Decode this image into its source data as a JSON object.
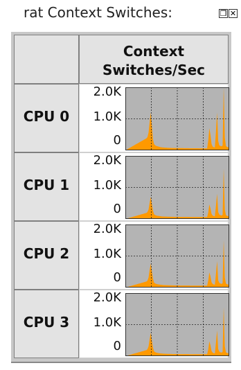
{
  "window": {
    "title": "rat Context Switches:",
    "buttons": {
      "restore_icon": "restore-icon",
      "close_icon": "close-icon"
    }
  },
  "table": {
    "column_header": [
      "Context",
      "Switches/Sec"
    ]
  },
  "rows": [
    {
      "label": "CPU 0"
    },
    {
      "label": "CPU 1"
    },
    {
      "label": "CPU 2"
    },
    {
      "label": "CPU 3"
    }
  ],
  "chart_data": [
    {
      "type": "area",
      "y_ticks": [
        "2.0K",
        "1.0K",
        "0"
      ],
      "ylim": [
        0,
        2000
      ],
      "grid": true,
      "colors": {
        "fill": "#ff9900",
        "background": "#b4b4b4",
        "grid": "#222222"
      },
      "series": [
        {
          "values": [
            0,
            20,
            40,
            60,
            80,
            100,
            120,
            140,
            160,
            180,
            200,
            220,
            240,
            260,
            280,
            300,
            320,
            340,
            360,
            380,
            420,
            560,
            900,
            1200,
            800,
            350,
            200,
            160,
            140,
            130,
            120,
            110,
            100,
            95,
            90,
            90,
            85,
            85,
            80,
            80,
            78,
            76,
            75,
            75,
            74,
            73,
            72,
            72,
            72,
            71,
            70,
            70,
            70,
            69,
            69,
            68,
            68,
            68,
            67,
            67,
            66,
            66,
            66,
            65,
            65,
            65,
            65,
            64,
            64,
            64,
            64,
            64,
            64,
            64,
            64,
            300,
            700,
            500,
            200,
            120,
            100,
            95,
            600,
            1200,
            300,
            160,
            140,
            130,
            150,
            2100,
            400,
            140,
            110,
            100,
            95
          ]
        }
      ]
    },
    {
      "type": "area",
      "y_ticks": [
        "2.0K",
        "1.0K",
        "0"
      ],
      "ylim": [
        0,
        2000
      ],
      "grid": true,
      "colors": {
        "fill": "#ff9900",
        "background": "#b4b4b4",
        "grid": "#222222"
      },
      "series": [
        {
          "values": [
            0,
            10,
            20,
            30,
            40,
            50,
            60,
            70,
            80,
            90,
            100,
            110,
            120,
            130,
            140,
            150,
            160,
            170,
            180,
            190,
            220,
            300,
            520,
            700,
            480,
            260,
            150,
            120,
            110,
            100,
            95,
            90,
            85,
            80,
            78,
            76,
            74,
            73,
            72,
            71,
            70,
            69,
            68,
            68,
            67,
            66,
            66,
            65,
            65,
            64,
            64,
            64,
            63,
            63,
            63,
            62,
            62,
            62,
            62,
            61,
            61,
            61,
            60,
            60,
            60,
            60,
            60,
            60,
            60,
            60,
            60,
            60,
            60,
            60,
            60,
            200,
            460,
            340,
            160,
            110,
            90,
            85,
            420,
            800,
            220,
            140,
            120,
            110,
            130,
            1600,
            300,
            120,
            100,
            90,
            85
          ]
        }
      ]
    },
    {
      "type": "area",
      "y_ticks": [
        "2.0K",
        "1.0K",
        "0"
      ],
      "ylim": [
        0,
        2000
      ],
      "grid": true,
      "colors": {
        "fill": "#ff9900",
        "background": "#b4b4b4",
        "grid": "#222222"
      },
      "series": [
        {
          "values": [
            0,
            10,
            20,
            30,
            40,
            50,
            60,
            70,
            80,
            90,
            100,
            110,
            120,
            130,
            140,
            150,
            160,
            170,
            180,
            190,
            220,
            320,
            560,
            760,
            520,
            280,
            160,
            130,
            115,
            105,
            98,
            92,
            88,
            84,
            80,
            78,
            76,
            74,
            73,
            72,
            71,
            70,
            69,
            68,
            67,
            67,
            66,
            66,
            65,
            65,
            64,
            64,
            64,
            63,
            63,
            63,
            62,
            62,
            62,
            61,
            61,
            61,
            61,
            60,
            60,
            60,
            60,
            60,
            60,
            60,
            60,
            60,
            60,
            60,
            60,
            220,
            480,
            360,
            170,
            115,
            95,
            90,
            440,
            840,
            230,
            150,
            125,
            115,
            135,
            1500,
            320,
            125,
            105,
            95,
            90
          ]
        }
      ]
    },
    {
      "type": "area",
      "y_ticks": [
        "2.0K",
        "1.0K",
        "0"
      ],
      "ylim": [
        0,
        2000
      ],
      "grid": true,
      "colors": {
        "fill": "#ff9900",
        "background": "#b4b4b4",
        "grid": "#222222"
      },
      "series": [
        {
          "values": [
            0,
            10,
            20,
            30,
            40,
            50,
            60,
            70,
            80,
            90,
            100,
            110,
            120,
            130,
            140,
            150,
            160,
            170,
            180,
            190,
            220,
            310,
            540,
            740,
            500,
            270,
            155,
            125,
            112,
            102,
            96,
            91,
            86,
            82,
            79,
            77,
            75,
            73,
            72,
            71,
            70,
            69,
            68,
            67,
            67,
            66,
            66,
            65,
            65,
            64,
            64,
            64,
            63,
            63,
            63,
            62,
            62,
            62,
            61,
            61,
            61,
            61,
            60,
            60,
            60,
            60,
            60,
            60,
            60,
            60,
            60,
            60,
            60,
            60,
            60,
            210,
            470,
            350,
            165,
            112,
            92,
            88,
            430,
            820,
            225,
            145,
            122,
            112,
            132,
            1550,
            310,
            122,
            102,
            92,
            88
          ]
        }
      ]
    }
  ]
}
